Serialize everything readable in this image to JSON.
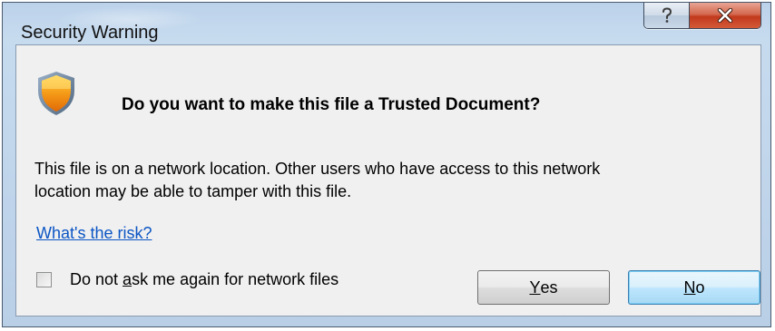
{
  "window": {
    "title": "Security Warning",
    "help_icon": "question-mark-icon",
    "close_icon": "close-x-icon"
  },
  "dialog": {
    "icon": "security-shield-icon",
    "heading": "Do you want to make this file a Trusted Document?",
    "body_line1": "This file is on a network location. Other users who have access to this network",
    "body_line2": "location may be able to tamper with this file.",
    "risk_link": "What's the risk?",
    "checkbox": {
      "label_pre": "Do not ",
      "label_mnemonic": "a",
      "label_post": "sk me again for network files",
      "checked": false
    },
    "buttons": {
      "yes": {
        "mnemonic": "Y",
        "rest": "es"
      },
      "no": {
        "mnemonic": "N",
        "rest": "o"
      }
    }
  },
  "colors": {
    "link": "#0b55c4",
    "close_button": "#c2391c",
    "default_button_border": "#3c7fb1"
  }
}
